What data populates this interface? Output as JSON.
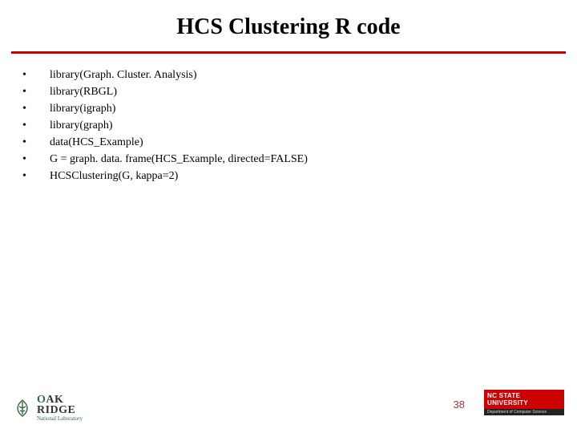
{
  "title": "HCS Clustering R code",
  "bullets": [
    "library(Graph. Cluster. Analysis)",
    "library(RBGL)",
    "library(igraph)",
    "library(graph)",
    "data(HCS_Example)",
    "G = graph. data. frame(HCS_Example, directed=FALSE)",
    "HCSClustering(G, kappa=2)"
  ],
  "footer": {
    "page_number": "38",
    "oak_ridge": {
      "top_first": "O",
      "top_rest": "AK",
      "bottom": "RIDGE",
      "sub": "National Laboratory"
    },
    "ncstate": {
      "main": "NC STATE UNIVERSITY",
      "sub": "Department of Computer Science"
    }
  }
}
